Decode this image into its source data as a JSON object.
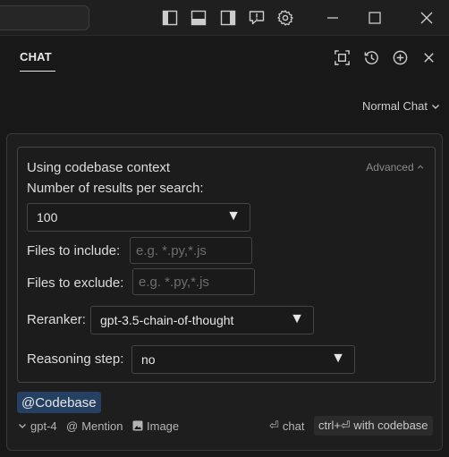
{
  "titlebar": {
    "icons": [
      "toggle-primary-sidebar-icon",
      "toggle-panel-icon",
      "toggle-secondary-sidebar-icon",
      "feedback-icon",
      "gear-icon",
      "minimize-icon",
      "maximize-icon",
      "close-icon"
    ]
  },
  "panel": {
    "tab_label": "CHAT",
    "icons": [
      "maximize-panel-icon",
      "history-icon",
      "new-chat-icon",
      "close-panel-icon"
    ],
    "mode_selected": "Normal Chat"
  },
  "context": {
    "title": "Using codebase context",
    "advanced_label": "Advanced",
    "results_label": "Number of results per search:",
    "results_value": "100",
    "include_label": "Files to include:",
    "include_placeholder": "e.g. *.py,*.js",
    "exclude_label": "Files to exclude:",
    "exclude_placeholder": "e.g. *.py,*.js",
    "reranker_label": "Reranker:",
    "reranker_value": "gpt-3.5-chain-of-thought",
    "reasoning_label": "Reasoning step:",
    "reasoning_value": "no"
  },
  "composer": {
    "mention_chip": "@Codebase",
    "model": "gpt-4",
    "mention_label": "Mention",
    "image_label": "Image",
    "chat_shortcut": "chat",
    "codebase_shortcut": "ctrl+⏎ with codebase"
  }
}
